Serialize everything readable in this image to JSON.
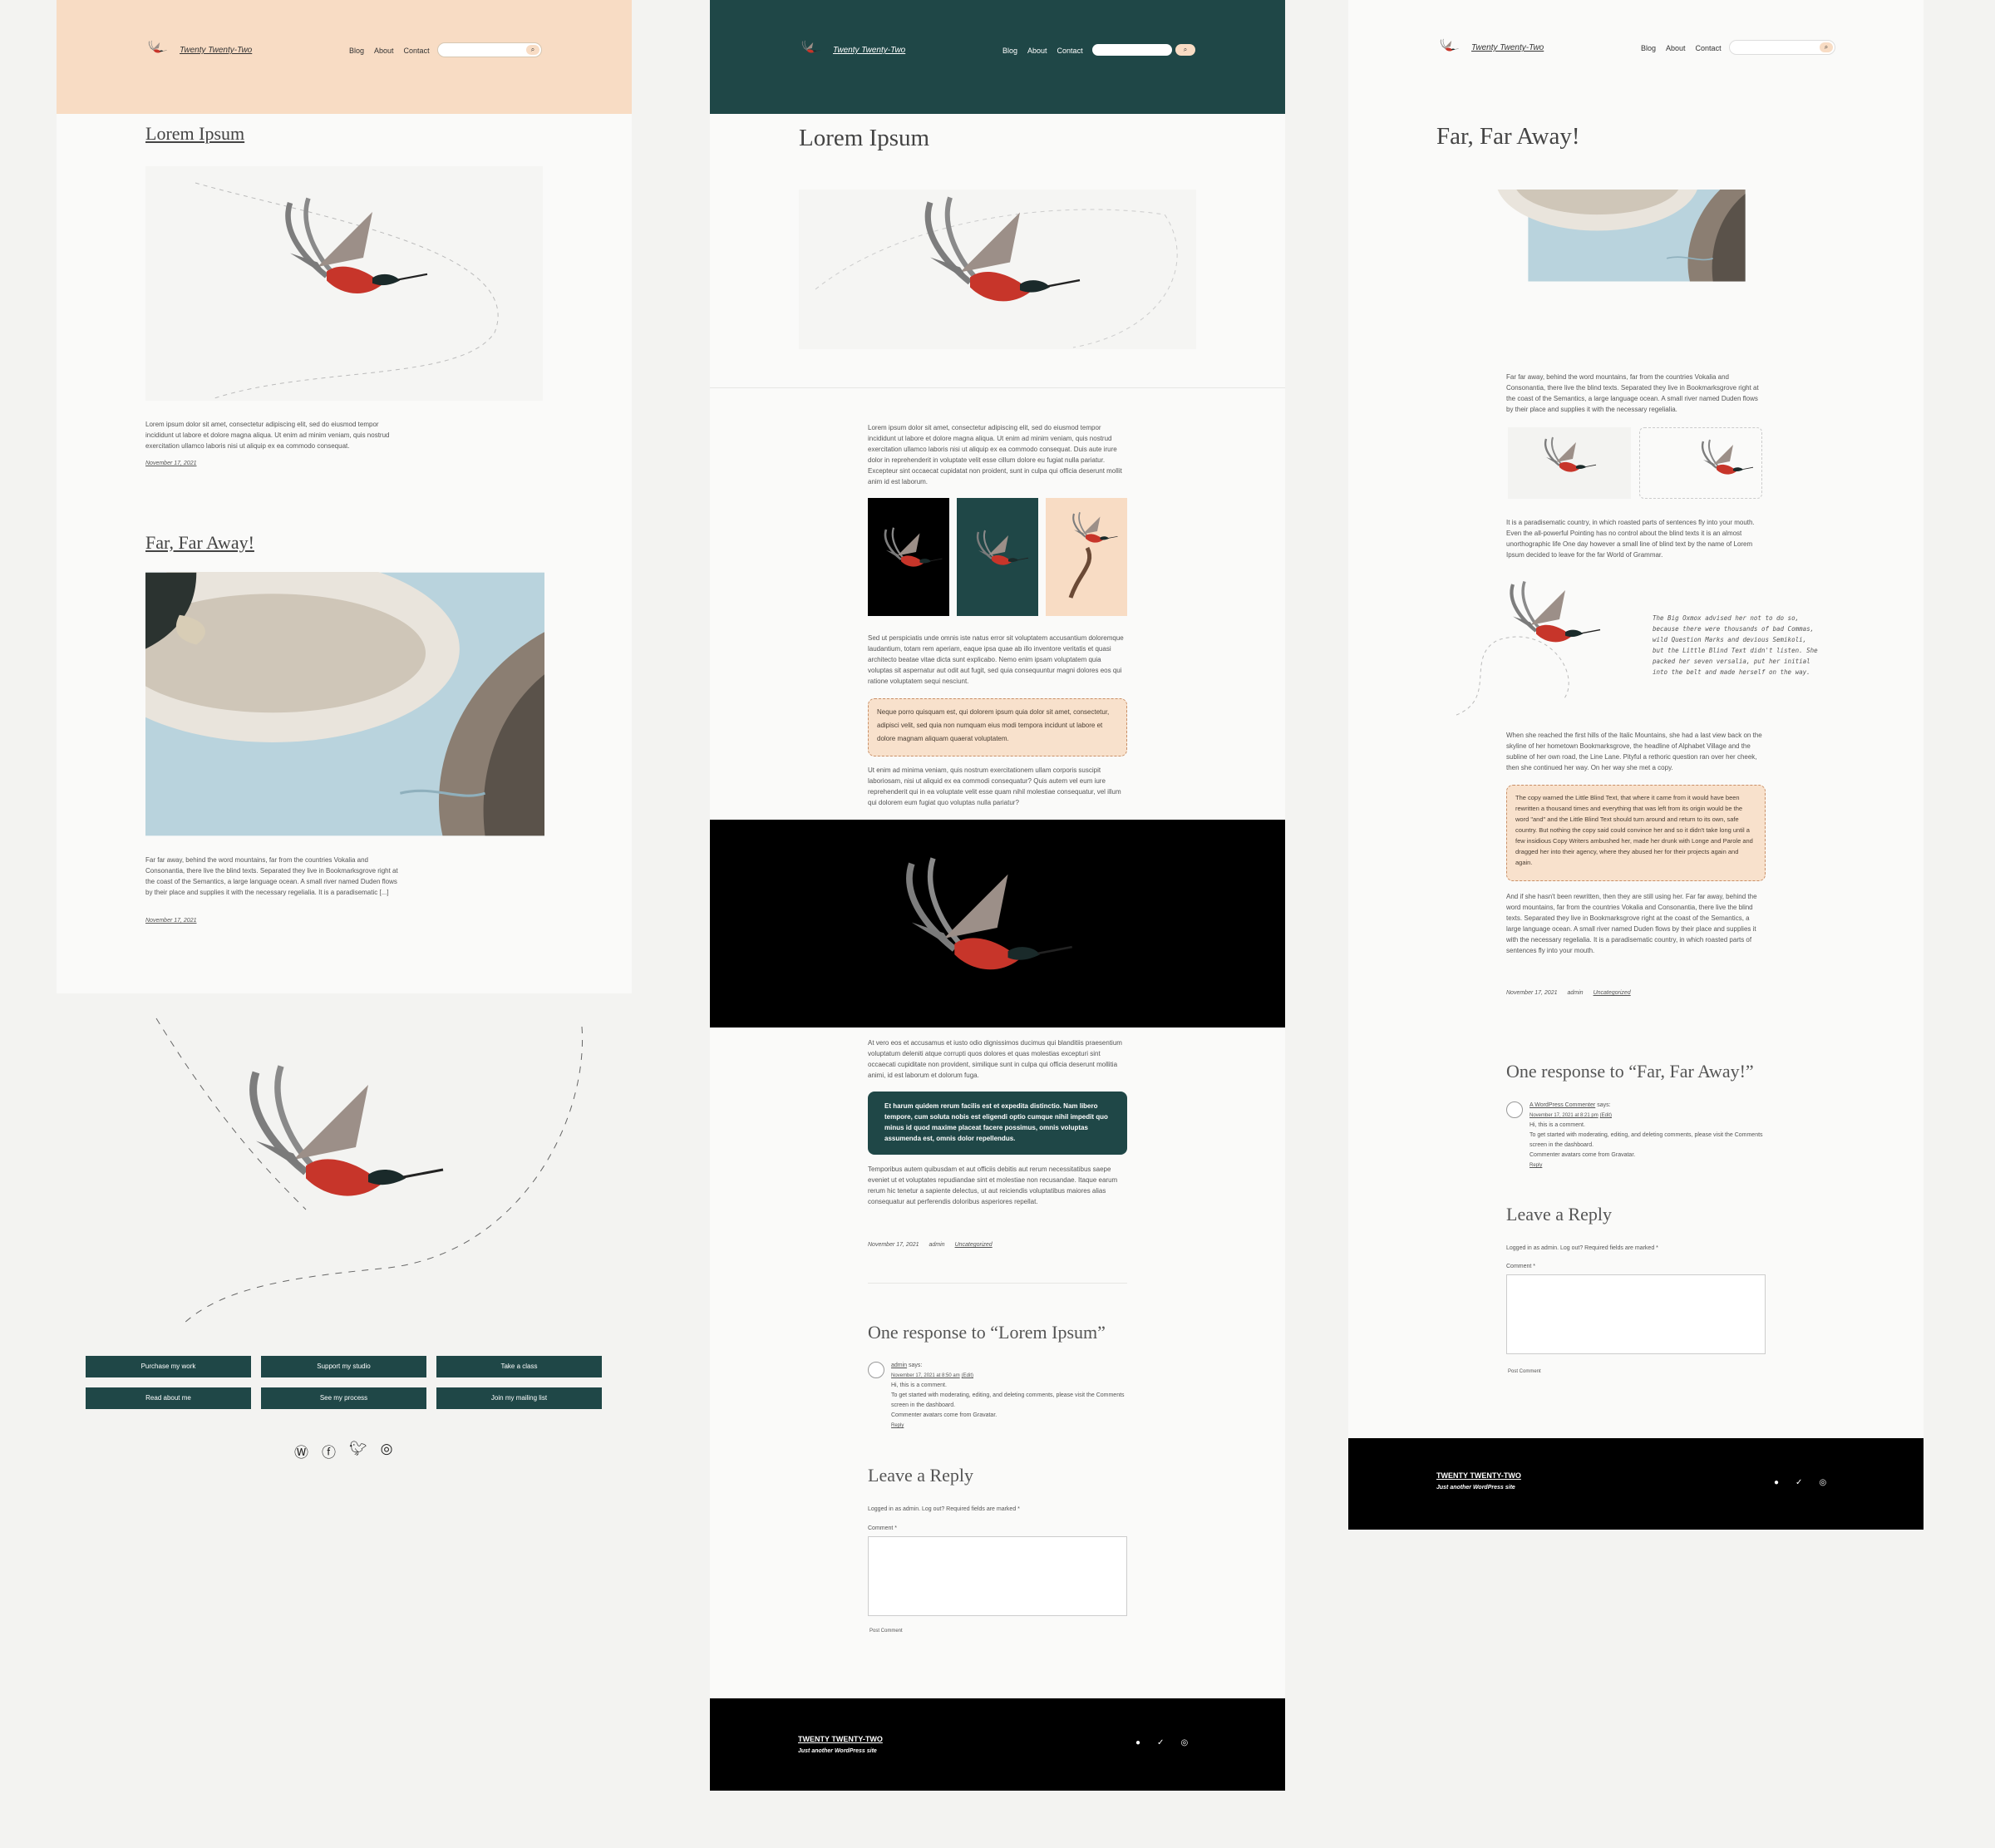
{
  "site": {
    "name": "Twenty Twenty-Two",
    "footer_name": "TWENTY TWENTY-TWO",
    "tagline": "Just another WordPress site"
  },
  "nav": {
    "blog": "Blog",
    "about": "About",
    "contact": "Contact"
  },
  "search": {
    "placeholder": "",
    "button_icon": "search-icon"
  },
  "colors": {
    "peach": "#f8dcc4",
    "dark_green": "#1f4747",
    "black": "#000000",
    "bg": "#fafaf9"
  },
  "left": {
    "post1": {
      "title": "Lorem Ipsum",
      "excerpt": "Lorem ipsum dolor sit amet, consectetur adipiscing elit, sed do eiusmod tempor incididunt ut labore et dolore magna aliqua. Ut enim ad minim veniam, quis nostrud exercitation ullamco laboris nisi ut aliquip ex ea commodo consequat.",
      "date": "November 17, 2021"
    },
    "post2": {
      "title": "Far, Far Away!",
      "excerpt": "Far far away, behind the word mountains, far from the countries Vokalia and Consonantia, there live the blind texts. Separated they live in Bookmarksgrove right at the coast of the Semantics, a large language ocean. A small river named Duden flows by their place and supplies it with the necessary regelialia. It is a paradisematic [...]",
      "date": "November 17, 2021"
    },
    "buttons": [
      "Purchase my work",
      "Support my studio",
      "Take a class",
      "Read about me",
      "See my process",
      "Join my mailing list"
    ],
    "social": [
      "wordpress-icon",
      "facebook-icon",
      "twitter-icon",
      "instagram-icon"
    ]
  },
  "middle": {
    "title": "Lorem Ipsum",
    "p1": "Lorem ipsum dolor sit amet, consectetur adipiscing elit, sed do eiusmod tempor incididunt ut labore et dolore magna aliqua. Ut enim ad minim veniam, quis nostrud exercitation ullamco laboris nisi ut aliquip ex ea commodo consequat. Duis aute irure dolor in reprehenderit in voluptate velit esse cillum dolore eu fugiat nulla pariatur. Excepteur sint occaecat cupidatat non proident, sunt in culpa qui officia deserunt mollit anim id est laborum.",
    "p2": "Sed ut perspiciatis unde omnis iste natus error sit voluptatem accusantium doloremque laudantium, totam rem aperiam, eaque ipsa quae ab illo inventore veritatis et quasi architecto beatae vitae dicta sunt explicabo. Nemo enim ipsam voluptatem quia voluptas sit aspernatur aut odit aut fugit, sed quia consequuntur magni dolores eos qui ratione voluptatem sequi nesciunt.",
    "callout1": "Neque porro quisquam est, qui dolorem ipsum quia dolor sit amet, consectetur, adipisci velit, sed quia non numquam eius modi tempora incidunt ut labore et dolore magnam aliquam quaerat voluptatem.",
    "p3": "Ut enim ad minima veniam, quis nostrum exercitationem ullam corporis suscipit laboriosam, nisi ut aliquid ex ea commodi consequatur? Quis autem vel eum iure reprehenderit qui in ea voluptate velit esse quam nihil molestiae consequatur, vel illum qui dolorem eum fugiat quo voluptas nulla pariatur?",
    "p4": "At vero eos et accusamus et iusto odio dignissimos ducimus qui blanditiis praesentium voluptatum deleniti atque corrupti quos dolores et quas molestias excepturi sint occaecati cupiditate non provident, similique sunt in culpa qui officia deserunt mollitia animi, id est laborum et dolorum fuga.",
    "callout2": "Et harum quidem rerum facilis est et expedita distinctio. Nam libero tempore, cum soluta nobis est eligendi optio cumque nihil impedit quo minus id quod maxime placeat facere possimus, omnis voluptas assumenda est, omnis dolor repellendus.",
    "p5": "Temporibus autem quibusdam et aut officiis debitis aut rerum necessitatibus saepe eveniet ut et voluptates repudiandae sint et molestiae non recusandae. Itaque earum rerum hic tenetur a sapiente delectus, ut aut reiciendis voluptatibus maiores alias consequatur aut perferendis doloribus asperiores repellat.",
    "meta_date": "November 17, 2021",
    "meta_author": "admin",
    "meta_category": "Uncategorized",
    "responses_title": "One response to “Lorem Ipsum”",
    "comment_author": "admin",
    "comment_says": "says:",
    "comment_date": "November 17, 2021 at 8:50 am",
    "comment_edit": "(Edit)",
    "comment_l1": "Hi, this is a comment.",
    "comment_l2": "To get started with moderating, editing, and deleting comments, please visit the Comments screen in the dashboard.",
    "comment_l3": "Commenter avatars come from Gravatar.",
    "reply": "Reply",
    "leave_reply": "Leave a Reply",
    "logged_in": "Logged in as admin. Log out? Required fields are marked *",
    "comment_label": "Comment *",
    "post_comment": "Post Comment"
  },
  "right": {
    "title": "Far, Far Away!",
    "p1": "Far far away, behind the word mountains, far from the countries Vokalia and Consonantia, there live the blind texts. Separated they live in Bookmarksgrove right at the coast of the Semantics, a large language ocean. A small river named Duden flows by their place and supplies it with the necessary regelialia.",
    "p2": "It is a paradisematic country, in which roasted parts of sentences fly into your mouth. Even the all-powerful Pointing has no control about the blind texts it is an almost unorthographic life One day however a small line of blind text by the name of Lorem Ipsum decided to leave for the far World of Grammar.",
    "quote": "The Big Oxmox advised her not to do so, because there were thousands of bad Commas, wild Question Marks and devious Semikoli, but the Little Blind Text didn't listen. She packed her seven versalia, put her initial into the belt and made herself on the way.",
    "p3": "When she reached the first hills of the Italic Mountains, she had a last view back on the skyline of her hometown Bookmarksgrove, the headline of Alphabet Village and the subline of her own road, the Line Lane. Pityful a rethoric question ran over her cheek, then she continued her way. On her way she met a copy.",
    "callout": "The copy warned the Little Blind Text, that where it came from it would have been rewritten a thousand times and everything that was left from its origin would be the word \"and\" and the Little Blind Text should turn around and return to its own, safe country. But nothing the copy said could convince her and so it didn't take long until a few insidious Copy Writers ambushed her, made her drunk with Longe and Parole and dragged her into their agency, where they abused her for their projects again and again.",
    "p4": "And if she hasn't been rewritten, then they are still using her. Far far away, behind the word mountains, far from the countries Vokalia and Consonantia, there live the blind texts. Separated they live in Bookmarksgrove right at the coast of the Semantics, a large language ocean. A small river named Duden flows by their place and supplies it with the necessary regelialia. It is a paradisematic country, in which roasted parts of sentences fly into your mouth.",
    "meta_date": "November 17, 2021",
    "meta_author": "admin",
    "meta_category": "Uncategorized",
    "responses_title": "One response to “Far, Far Away!”",
    "comment_author": "A WordPress Commenter",
    "comment_says": "says:",
    "comment_date": "November 17, 2021 at 8:21 pm",
    "comment_edit": "(Edit)",
    "comment_l1": "Hi, this is a comment.",
    "comment_l2": "To get started with moderating, editing, and deleting comments, please visit the Comments screen in the dashboard.",
    "comment_l3": "Commenter avatars come from Gravatar.",
    "reply": "Reply",
    "leave_reply": "Leave a Reply",
    "logged_in": "Logged in as admin. Log out? Required fields are marked *",
    "comment_label": "Comment *",
    "post_comment": "Post Comment"
  }
}
